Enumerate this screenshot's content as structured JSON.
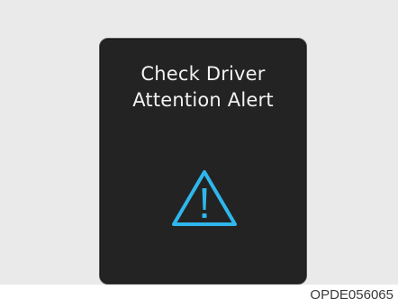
{
  "display": {
    "title_line1": "Check Driver",
    "title_line2": "Attention Alert",
    "icon": "warning-triangle-icon",
    "icon_color": "#2fb7ec",
    "background_color": "#232323",
    "text_color": "#f2f2f2"
  },
  "figure": {
    "code": "OPDE056065"
  }
}
